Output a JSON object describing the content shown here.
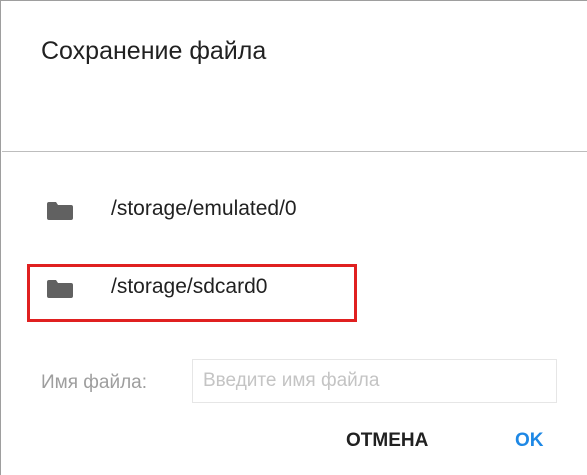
{
  "dialog": {
    "title": "Сохранение файла"
  },
  "locations": [
    {
      "icon": "folder-icon",
      "path": "/storage/emulated/0"
    },
    {
      "icon": "folder-icon",
      "path": "/storage/sdcard0",
      "highlighted": true
    }
  ],
  "filename": {
    "label": "Имя файла:",
    "value": "",
    "placeholder": "Введите имя файла"
  },
  "buttons": {
    "cancel_label": "ОТМЕНА",
    "ok_label": "OK"
  },
  "colors": {
    "accent": "#1e88e5",
    "highlight": "#e02020",
    "icon": "#616161"
  }
}
